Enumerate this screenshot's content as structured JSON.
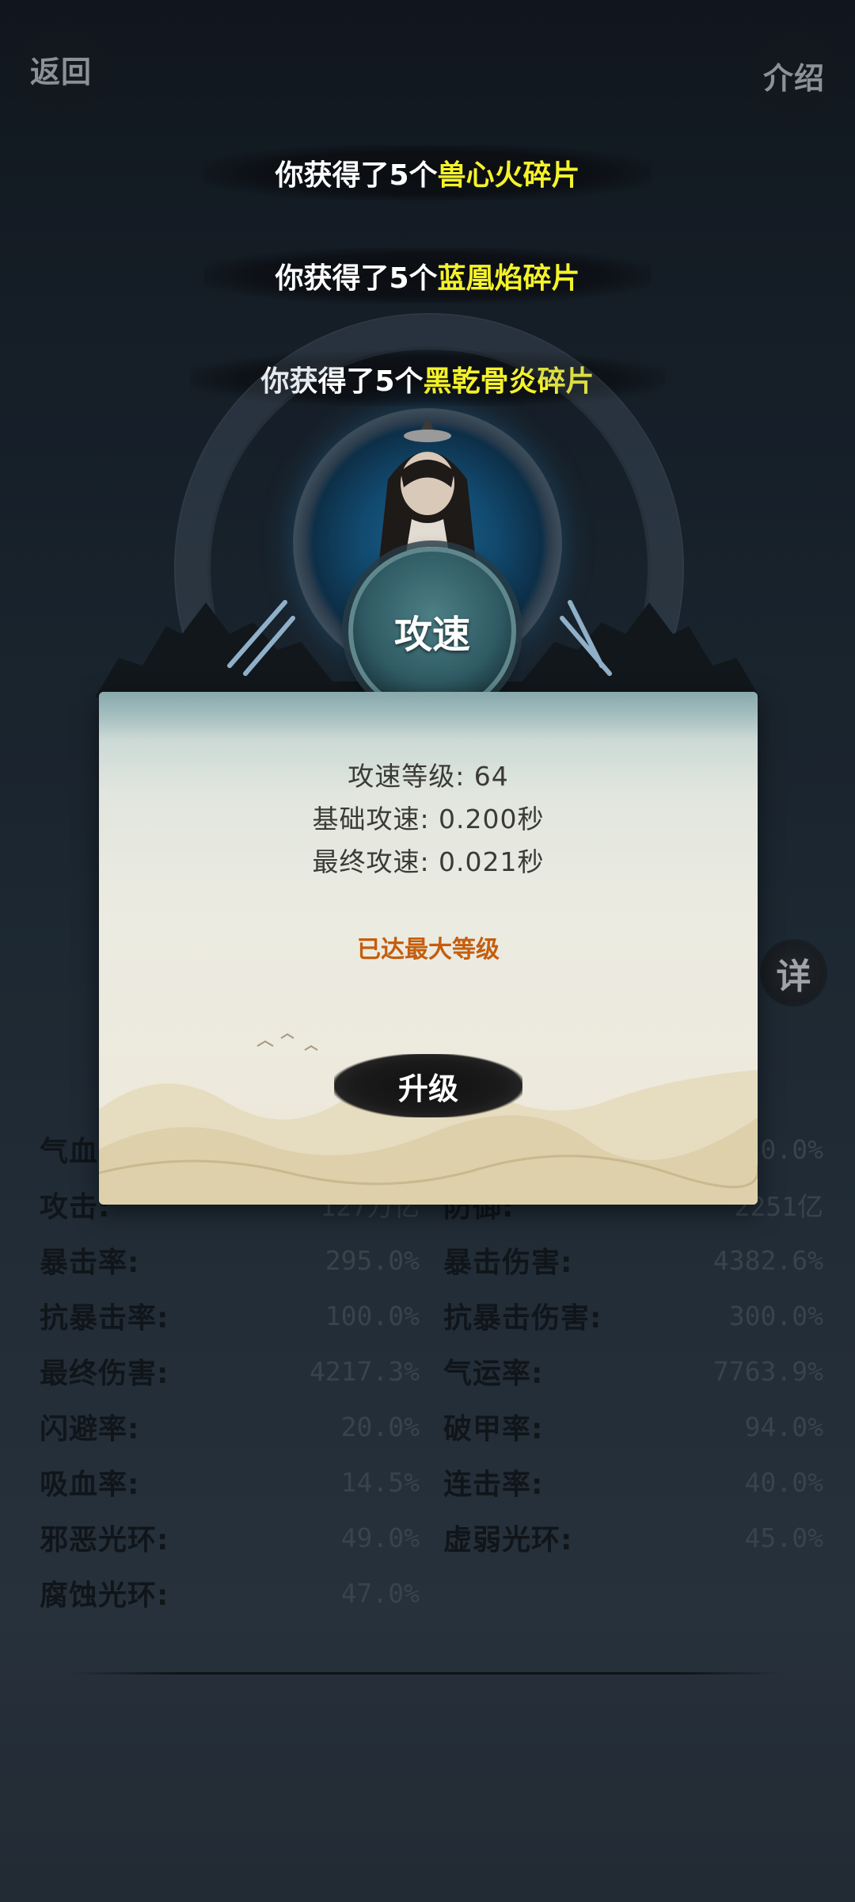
{
  "header": {
    "back_label": "返回",
    "intro_label": "介绍"
  },
  "notifications": [
    {
      "prefix": "你获得了5个",
      "item": "兽心火碎片"
    },
    {
      "prefix": "你获得了5个",
      "item": "蓝凰焰碎片"
    },
    {
      "prefix": "你获得了5个",
      "item": "黑乾骨炎碎片"
    }
  ],
  "skill": {
    "name": "攻速"
  },
  "modal": {
    "lines": [
      "攻速等级: 64",
      "基础攻速: 0.200秒",
      "最终攻速: 0.021秒"
    ],
    "status": "已达最大等级",
    "upgrade_label": "升级"
  },
  "detail_label": "详",
  "stats": {
    "left": [
      {
        "label": "气血:",
        "value": ""
      },
      {
        "label": "攻击:",
        "value": "127万亿"
      },
      {
        "label": "暴击率:",
        "value": "295.0%"
      },
      {
        "label": "抗暴击率:",
        "value": "100.0%"
      },
      {
        "label": "最终伤害:",
        "value": "4217.3%"
      },
      {
        "label": "闪避率:",
        "value": "20.0%"
      },
      {
        "label": "吸血率:",
        "value": "14.5%"
      },
      {
        "label": "邪恶光环:",
        "value": "49.0%"
      },
      {
        "label": "腐蚀光环:",
        "value": "47.0%"
      }
    ],
    "right": [
      {
        "label": "",
        "value": "0.0%"
      },
      {
        "label": "防御:",
        "value": "2251亿"
      },
      {
        "label": "暴击伤害:",
        "value": "4382.6%"
      },
      {
        "label": "抗暴击伤害:",
        "value": "300.0%"
      },
      {
        "label": "气运率:",
        "value": "7763.9%"
      },
      {
        "label": "破甲率:",
        "value": "94.0%"
      },
      {
        "label": "连击率:",
        "value": "40.0%"
      },
      {
        "label": "虚弱光环:",
        "value": "45.0%"
      }
    ]
  }
}
